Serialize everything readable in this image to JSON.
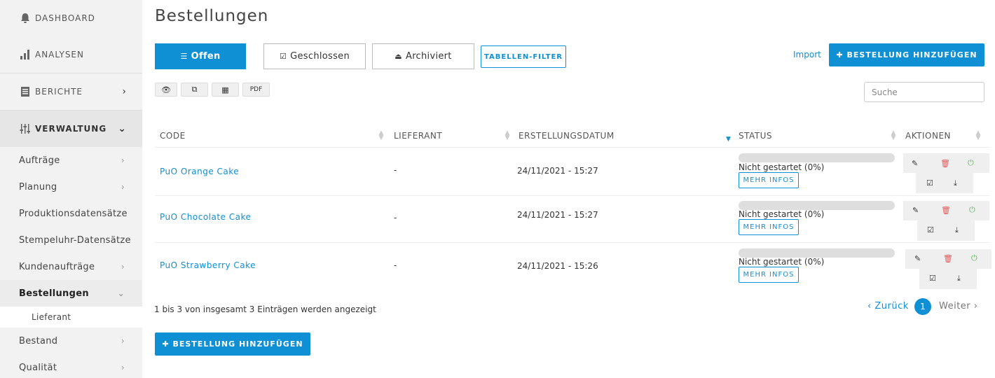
{
  "sidebar": {
    "main": [
      {
        "label": "DASHBOARD",
        "icon": "bell-icon"
      },
      {
        "label": "ANALYSEN",
        "icon": "bar-chart-icon"
      },
      {
        "label": "BERICHTE",
        "icon": "document-icon"
      },
      {
        "label": "VERWALTUNG",
        "icon": "sliders-icon"
      }
    ],
    "sub": [
      {
        "label": "Aufträge"
      },
      {
        "label": "Planung"
      },
      {
        "label": "Produktionsdatensätze"
      },
      {
        "label": "Stempeluhr-Datensätze"
      },
      {
        "label": "Kundenaufträge"
      },
      {
        "label": "Bestellungen"
      },
      {
        "label": "Lieferant"
      },
      {
        "label": "Bestand"
      },
      {
        "label": "Qualität"
      }
    ]
  },
  "page": {
    "title": "Bestellungen"
  },
  "tabs": [
    {
      "label": "Offen",
      "icon": "list-icon"
    },
    {
      "label": "Geschlossen",
      "icon": "checkbox-icon"
    },
    {
      "label": "Archiviert",
      "icon": "inbox-icon"
    }
  ],
  "toolbar": {
    "filter_label": "TABELLEN-FILTER",
    "import_label": "Import",
    "add_label": "BESTELLUNG HINZUFÜGEN",
    "pdf_label": "PDF",
    "search_placeholder": "Suche"
  },
  "table": {
    "headers": [
      "CODE",
      "LIEFERANT",
      "ERSTELLUNGSDATUM",
      "STATUS",
      "AKTIONEN"
    ],
    "rows": [
      {
        "code": "PuO Orange Cake",
        "supplier": "-",
        "date": "24/11/2021 - 15:27",
        "status": "Nicht gestartet (0%)",
        "progress": 0,
        "more": "MEHR INFOS"
      },
      {
        "code": "PuO Chocolate Cake",
        "supplier": "-",
        "date": "24/11/2021 - 15:27",
        "status": "Nicht gestartet (0%)",
        "progress": 0,
        "more": "MEHR INFOS"
      },
      {
        "code": "PuO Strawberry Cake",
        "supplier": "-",
        "date": "24/11/2021 - 15:26",
        "status": "Nicht gestartet (0%)",
        "progress": 0,
        "more": "MEHR INFOS"
      }
    ]
  },
  "footer": {
    "info": "1 bis 3 von insgesamt 3 Einträgen werden angezeigt",
    "prev": "Zurück",
    "page": "1",
    "next": "Weiter",
    "add_label": "BESTELLUNG HINZUFÜGEN"
  },
  "colors": {
    "accent": "#0f8fd4",
    "delete": "#e05a5a",
    "power": "#5cb85c"
  }
}
